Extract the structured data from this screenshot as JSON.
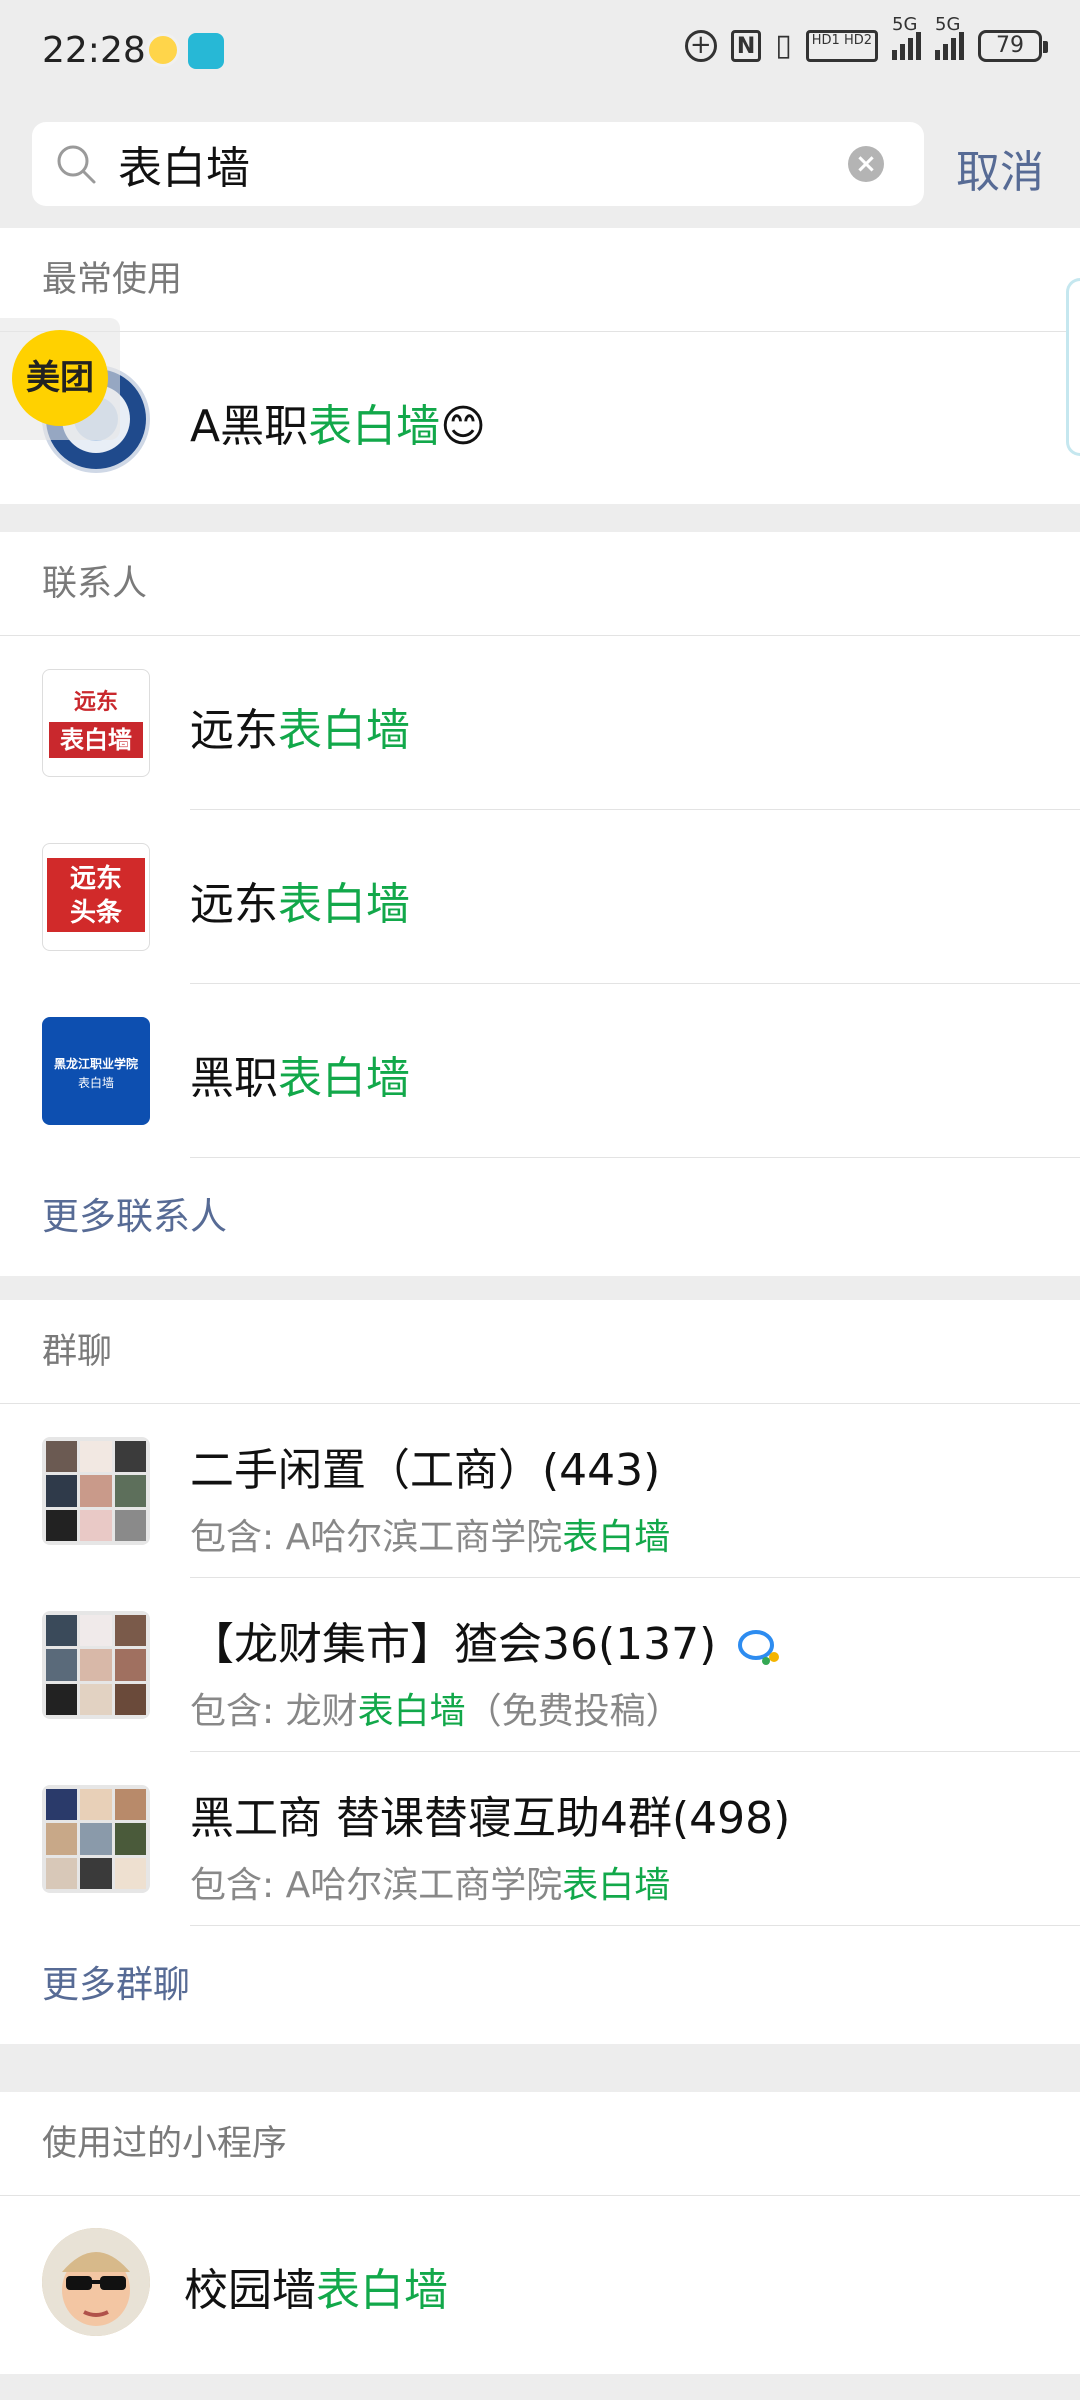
{
  "status_bar": {
    "time": "22:28",
    "network": "5G",
    "network2": "5G",
    "hd": "HD1 HD2",
    "battery": "79"
  },
  "search": {
    "query": "表白墙",
    "cancel_label": "取消"
  },
  "floater": {
    "label": "美团"
  },
  "sections": {
    "recent": {
      "header": "最常使用",
      "items": [
        {
          "prefix": "A黑职",
          "highlight": "表白墙",
          "emoji": "😊"
        }
      ]
    },
    "contacts": {
      "header": "联系人",
      "items": [
        {
          "prefix": "远东",
          "highlight": "表白墙",
          "avatar_text_top": "远东",
          "avatar_text_bottom": "表白墙"
        },
        {
          "prefix": "远东",
          "highlight": "表白墙",
          "avatar_text_top": "远东",
          "avatar_text_bottom": "头条"
        },
        {
          "prefix": "黑职",
          "highlight": "表白墙",
          "avatar_text_top": "黑龙江职业学院",
          "avatar_text_bottom": "表白墙"
        }
      ],
      "more_label": "更多联系人"
    },
    "groups": {
      "header": "群聊",
      "items": [
        {
          "title": "二手闲置（工商）(443)",
          "sub_prefix": "包含: A哈尔滨工商学院",
          "sub_highlight": "表白墙",
          "sub_suffix": ""
        },
        {
          "title": "【龙财集市】猹会36(137)",
          "sub_prefix": "包含: 龙财",
          "sub_highlight": "表白墙",
          "sub_suffix": "（免费投稿）"
        },
        {
          "title": "黑工商 替课替寝互助4群(498)",
          "sub_prefix": "包含: A哈尔滨工商学院",
          "sub_highlight": "表白墙",
          "sub_suffix": ""
        }
      ],
      "more_label": "更多群聊"
    },
    "mini_programs": {
      "header": "使用过的小程序",
      "items": [
        {
          "prefix": "校园墙",
          "highlight": "表白墙"
        }
      ]
    }
  },
  "colors": {
    "highlight": "#12a84a",
    "link": "#576b95",
    "background": "#ededed"
  }
}
